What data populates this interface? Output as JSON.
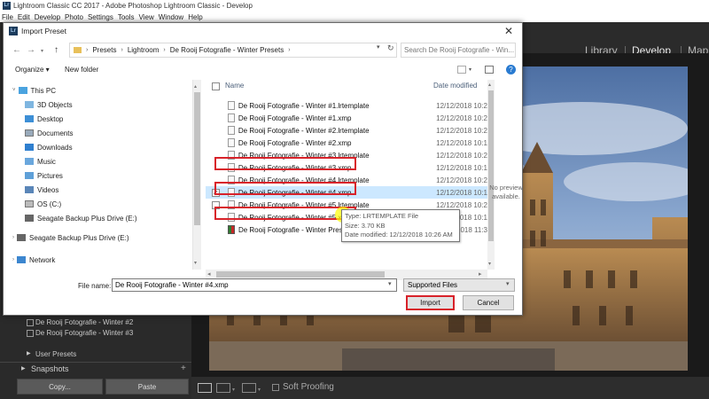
{
  "app": {
    "title": "Lightroom Classic CC 2017 - Adobe Photoshop Lightroom Classic - Develop",
    "logo_text": "Lr",
    "menu": [
      "File",
      "Edit",
      "Develop",
      "Photo",
      "Settings",
      "Tools",
      "View",
      "Window",
      "Help"
    ],
    "modules": [
      "Library",
      "Develop",
      "Map"
    ],
    "left_panel": {
      "preset_items": [
        "De Rooij Fotografie - Winter #2",
        "De Rooij Fotografie - Winter #3"
      ],
      "user_presets": "User Presets",
      "snapshots": "Snapshots",
      "copy_button": "Copy...",
      "paste_button": "Paste"
    },
    "toolbar": {
      "soft_proofing": "Soft Proofing"
    }
  },
  "dialog": {
    "title": "Import Preset",
    "close_glyph": "✕",
    "breadcrumb": [
      "Presets",
      "Lightroom",
      "De Rooij Fotografie - Winter Presets"
    ],
    "search_placeholder": "Search De Rooij Fotografie - Win...",
    "organize": "Organize ▾",
    "new_folder": "New folder",
    "help_glyph": "?",
    "nav_items": [
      {
        "label": "This PC",
        "icon": "computer-icon",
        "indent": 0
      },
      {
        "label": "3D Objects",
        "icon": "folder-3d-icon",
        "indent": 1
      },
      {
        "label": "Desktop",
        "icon": "desktop-icon",
        "indent": 1
      },
      {
        "label": "Documents",
        "icon": "documents-icon",
        "indent": 1
      },
      {
        "label": "Downloads",
        "icon": "downloads-icon",
        "indent": 1
      },
      {
        "label": "Music",
        "icon": "music-icon",
        "indent": 1
      },
      {
        "label": "Pictures",
        "icon": "pictures-icon",
        "indent": 1
      },
      {
        "label": "Videos",
        "icon": "videos-icon",
        "indent": 1
      },
      {
        "label": "OS (C:)",
        "icon": "drive-icon",
        "indent": 1
      },
      {
        "label": "Seagate Backup Plus Drive (E:)",
        "icon": "usb-drive-icon",
        "indent": 1
      },
      {
        "label": "Seagate Backup Plus Drive (E:)",
        "icon": "usb-drive-icon",
        "indent": 0
      },
      {
        "label": "Network",
        "icon": "network-icon",
        "indent": 0
      }
    ],
    "columns": {
      "name": "Name",
      "date": "Date modified"
    },
    "files": [
      {
        "name": "De Rooij Fotografie - Winter #1.lrtemplate",
        "date": "12/12/2018 10:2"
      },
      {
        "name": "De Rooij Fotografie - Winter #1.xmp",
        "date": "12/12/2018 10:2"
      },
      {
        "name": "De Rooij Fotografie - Winter #2.lrtemplate",
        "date": "12/12/2018 10:2"
      },
      {
        "name": "De Rooij Fotografie - Winter #2.xmp",
        "date": "12/12/2018 10:1"
      },
      {
        "name": "De Rooij Fotografie - Winter #3.lrtemplate",
        "date": "12/12/2018 10:2"
      },
      {
        "name": "De Rooij Fotografie - Winter #3.xmp",
        "date": "12/12/2018 10:1"
      },
      {
        "name": "De Rooij Fotografie - Winter #4.lrtemplate",
        "date": "12/12/2018 10:2"
      },
      {
        "name": "De Rooij Fotografie - Winter #4.xmp",
        "date": "12/12/2018 10:1"
      },
      {
        "name": "De Rooij Fotografie - Winter #5.lrtemplate",
        "date": "12/12/2018 10:2"
      },
      {
        "name": "De Rooij Fotografie - Winter #5.xmp",
        "date": "12/12/2018 10:1"
      },
      {
        "name": "De Rooij Fotografie - Winter Presets",
        "date": "12/12/2018 11:3"
      }
    ],
    "tooltip": {
      "type": "Type: LRTEMPLATE File",
      "size": "Size: 3.70 KB",
      "modified": "Date modified: 12/12/2018 10:26 AM"
    },
    "preview_text": "No preview available.",
    "file_name_label": "File name:",
    "file_name_value": "De Rooij Fotografie - Winter #4.xmp",
    "filter": "Supported Files",
    "import_button": "Import",
    "cancel_button": "Cancel"
  },
  "colors": {
    "highlight_box": "#d8222a",
    "selection": "#cce8ff",
    "cursor_highlight": "#ffff00"
  }
}
